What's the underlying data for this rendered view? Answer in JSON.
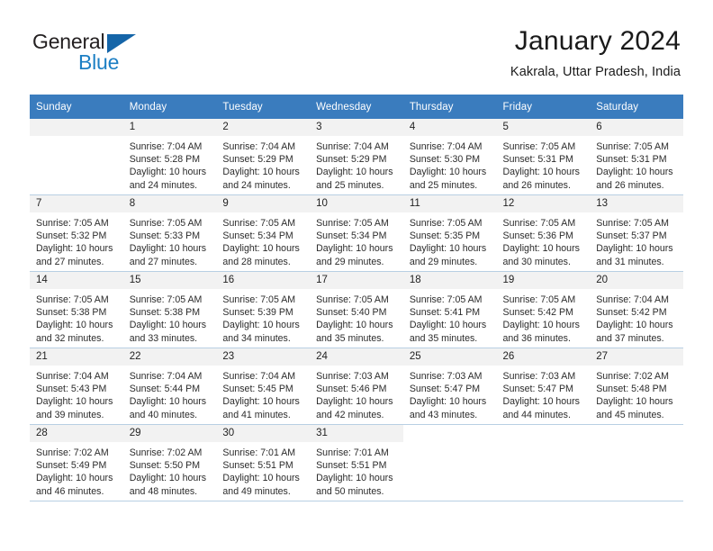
{
  "brand": {
    "name_part1": "General",
    "name_part2": "Blue",
    "logo_icon": "triangle-logo-icon"
  },
  "header": {
    "title": "January 2024",
    "subtitle": "Kakrala, Uttar Pradesh, India"
  },
  "calendar": {
    "weekday_headers": [
      "Sunday",
      "Monday",
      "Tuesday",
      "Wednesday",
      "Thursday",
      "Friday",
      "Saturday"
    ],
    "colors": {
      "header_bg": "#3a7cbe",
      "header_text": "#ffffff",
      "daynum_bg": "#f2f2f2",
      "row_border": "#b8cfe3",
      "brand_blue": "#1c7fc4",
      "logo_blue": "#1565a8"
    },
    "weeks": [
      [
        {
          "day": "",
          "sunrise": "",
          "sunset": "",
          "daylight1": "",
          "daylight2": ""
        },
        {
          "day": "1",
          "sunrise": "Sunrise: 7:04 AM",
          "sunset": "Sunset: 5:28 PM",
          "daylight1": "Daylight: 10 hours",
          "daylight2": "and 24 minutes."
        },
        {
          "day": "2",
          "sunrise": "Sunrise: 7:04 AM",
          "sunset": "Sunset: 5:29 PM",
          "daylight1": "Daylight: 10 hours",
          "daylight2": "and 24 minutes."
        },
        {
          "day": "3",
          "sunrise": "Sunrise: 7:04 AM",
          "sunset": "Sunset: 5:29 PM",
          "daylight1": "Daylight: 10 hours",
          "daylight2": "and 25 minutes."
        },
        {
          "day": "4",
          "sunrise": "Sunrise: 7:04 AM",
          "sunset": "Sunset: 5:30 PM",
          "daylight1": "Daylight: 10 hours",
          "daylight2": "and 25 minutes."
        },
        {
          "day": "5",
          "sunrise": "Sunrise: 7:05 AM",
          "sunset": "Sunset: 5:31 PM",
          "daylight1": "Daylight: 10 hours",
          "daylight2": "and 26 minutes."
        },
        {
          "day": "6",
          "sunrise": "Sunrise: 7:05 AM",
          "sunset": "Sunset: 5:31 PM",
          "daylight1": "Daylight: 10 hours",
          "daylight2": "and 26 minutes."
        }
      ],
      [
        {
          "day": "7",
          "sunrise": "Sunrise: 7:05 AM",
          "sunset": "Sunset: 5:32 PM",
          "daylight1": "Daylight: 10 hours",
          "daylight2": "and 27 minutes."
        },
        {
          "day": "8",
          "sunrise": "Sunrise: 7:05 AM",
          "sunset": "Sunset: 5:33 PM",
          "daylight1": "Daylight: 10 hours",
          "daylight2": "and 27 minutes."
        },
        {
          "day": "9",
          "sunrise": "Sunrise: 7:05 AM",
          "sunset": "Sunset: 5:34 PM",
          "daylight1": "Daylight: 10 hours",
          "daylight2": "and 28 minutes."
        },
        {
          "day": "10",
          "sunrise": "Sunrise: 7:05 AM",
          "sunset": "Sunset: 5:34 PM",
          "daylight1": "Daylight: 10 hours",
          "daylight2": "and 29 minutes."
        },
        {
          "day": "11",
          "sunrise": "Sunrise: 7:05 AM",
          "sunset": "Sunset: 5:35 PM",
          "daylight1": "Daylight: 10 hours",
          "daylight2": "and 29 minutes."
        },
        {
          "day": "12",
          "sunrise": "Sunrise: 7:05 AM",
          "sunset": "Sunset: 5:36 PM",
          "daylight1": "Daylight: 10 hours",
          "daylight2": "and 30 minutes."
        },
        {
          "day": "13",
          "sunrise": "Sunrise: 7:05 AM",
          "sunset": "Sunset: 5:37 PM",
          "daylight1": "Daylight: 10 hours",
          "daylight2": "and 31 minutes."
        }
      ],
      [
        {
          "day": "14",
          "sunrise": "Sunrise: 7:05 AM",
          "sunset": "Sunset: 5:38 PM",
          "daylight1": "Daylight: 10 hours",
          "daylight2": "and 32 minutes."
        },
        {
          "day": "15",
          "sunrise": "Sunrise: 7:05 AM",
          "sunset": "Sunset: 5:38 PM",
          "daylight1": "Daylight: 10 hours",
          "daylight2": "and 33 minutes."
        },
        {
          "day": "16",
          "sunrise": "Sunrise: 7:05 AM",
          "sunset": "Sunset: 5:39 PM",
          "daylight1": "Daylight: 10 hours",
          "daylight2": "and 34 minutes."
        },
        {
          "day": "17",
          "sunrise": "Sunrise: 7:05 AM",
          "sunset": "Sunset: 5:40 PM",
          "daylight1": "Daylight: 10 hours",
          "daylight2": "and 35 minutes."
        },
        {
          "day": "18",
          "sunrise": "Sunrise: 7:05 AM",
          "sunset": "Sunset: 5:41 PM",
          "daylight1": "Daylight: 10 hours",
          "daylight2": "and 35 minutes."
        },
        {
          "day": "19",
          "sunrise": "Sunrise: 7:05 AM",
          "sunset": "Sunset: 5:42 PM",
          "daylight1": "Daylight: 10 hours",
          "daylight2": "and 36 minutes."
        },
        {
          "day": "20",
          "sunrise": "Sunrise: 7:04 AM",
          "sunset": "Sunset: 5:42 PM",
          "daylight1": "Daylight: 10 hours",
          "daylight2": "and 37 minutes."
        }
      ],
      [
        {
          "day": "21",
          "sunrise": "Sunrise: 7:04 AM",
          "sunset": "Sunset: 5:43 PM",
          "daylight1": "Daylight: 10 hours",
          "daylight2": "and 39 minutes."
        },
        {
          "day": "22",
          "sunrise": "Sunrise: 7:04 AM",
          "sunset": "Sunset: 5:44 PM",
          "daylight1": "Daylight: 10 hours",
          "daylight2": "and 40 minutes."
        },
        {
          "day": "23",
          "sunrise": "Sunrise: 7:04 AM",
          "sunset": "Sunset: 5:45 PM",
          "daylight1": "Daylight: 10 hours",
          "daylight2": "and 41 minutes."
        },
        {
          "day": "24",
          "sunrise": "Sunrise: 7:03 AM",
          "sunset": "Sunset: 5:46 PM",
          "daylight1": "Daylight: 10 hours",
          "daylight2": "and 42 minutes."
        },
        {
          "day": "25",
          "sunrise": "Sunrise: 7:03 AM",
          "sunset": "Sunset: 5:47 PM",
          "daylight1": "Daylight: 10 hours",
          "daylight2": "and 43 minutes."
        },
        {
          "day": "26",
          "sunrise": "Sunrise: 7:03 AM",
          "sunset": "Sunset: 5:47 PM",
          "daylight1": "Daylight: 10 hours",
          "daylight2": "and 44 minutes."
        },
        {
          "day": "27",
          "sunrise": "Sunrise: 7:02 AM",
          "sunset": "Sunset: 5:48 PM",
          "daylight1": "Daylight: 10 hours",
          "daylight2": "and 45 minutes."
        }
      ],
      [
        {
          "day": "28",
          "sunrise": "Sunrise: 7:02 AM",
          "sunset": "Sunset: 5:49 PM",
          "daylight1": "Daylight: 10 hours",
          "daylight2": "and 46 minutes."
        },
        {
          "day": "29",
          "sunrise": "Sunrise: 7:02 AM",
          "sunset": "Sunset: 5:50 PM",
          "daylight1": "Daylight: 10 hours",
          "daylight2": "and 48 minutes."
        },
        {
          "day": "30",
          "sunrise": "Sunrise: 7:01 AM",
          "sunset": "Sunset: 5:51 PM",
          "daylight1": "Daylight: 10 hours",
          "daylight2": "and 49 minutes."
        },
        {
          "day": "31",
          "sunrise": "Sunrise: 7:01 AM",
          "sunset": "Sunset: 5:51 PM",
          "daylight1": "Daylight: 10 hours",
          "daylight2": "and 50 minutes."
        },
        {
          "day": "",
          "sunrise": "",
          "sunset": "",
          "daylight1": "",
          "daylight2": ""
        },
        {
          "day": "",
          "sunrise": "",
          "sunset": "",
          "daylight1": "",
          "daylight2": ""
        },
        {
          "day": "",
          "sunrise": "",
          "sunset": "",
          "daylight1": "",
          "daylight2": ""
        }
      ]
    ]
  }
}
